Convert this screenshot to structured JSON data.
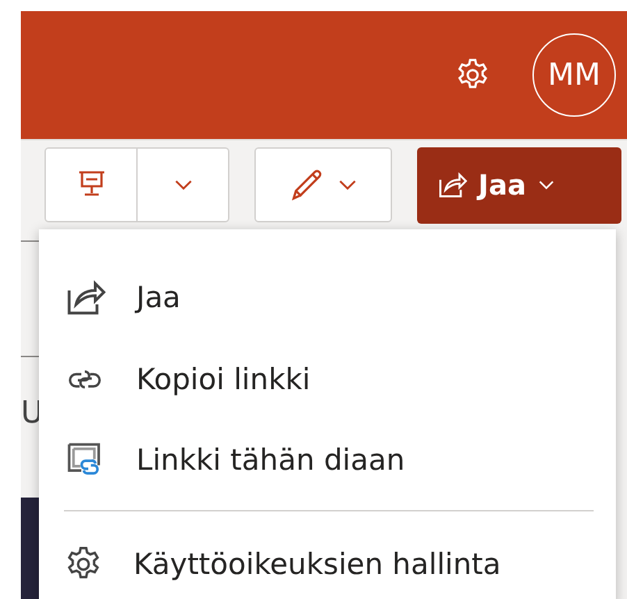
{
  "header": {
    "avatar": "MM"
  },
  "toolbar": {
    "share_button": "Jaa"
  },
  "background": {
    "fragment": "U"
  },
  "menu": {
    "items": [
      {
        "kind": "share",
        "label": "Jaa"
      },
      {
        "kind": "link",
        "label": "Kopioi linkki"
      },
      {
        "kind": "slide-link",
        "label": "Linkki tähän diaan"
      },
      {
        "kind": "separator"
      },
      {
        "kind": "settings",
        "label": "Käyttöoikeuksien hallinta"
      }
    ]
  }
}
